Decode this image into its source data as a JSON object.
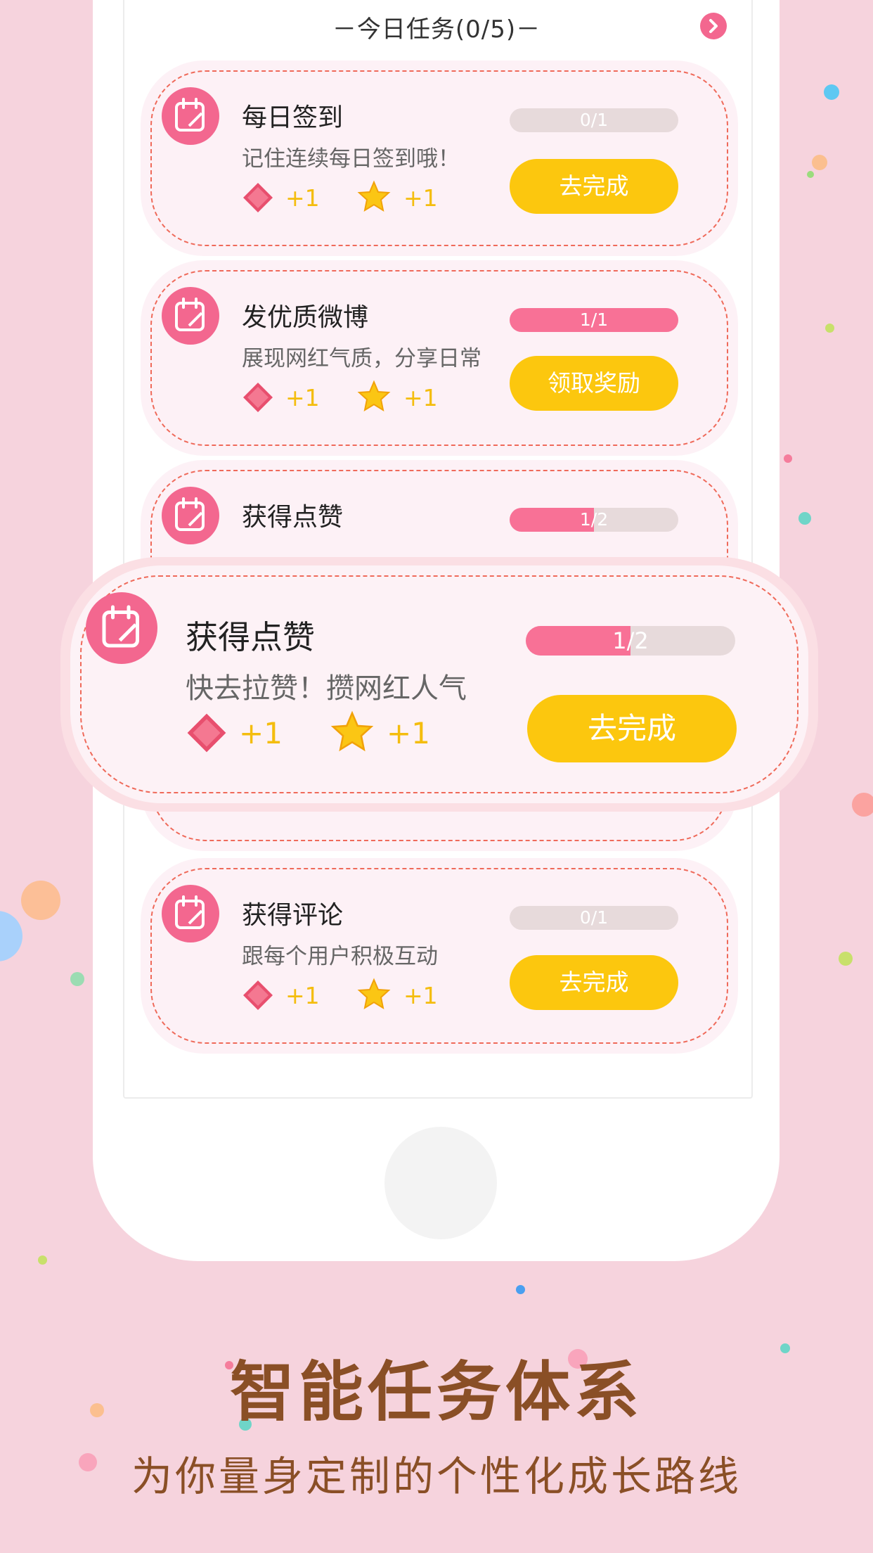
{
  "section": {
    "title": "－今日任务(0/5)－",
    "next_icon": "chevron-right-icon"
  },
  "reward_icons": {
    "gem": "diamond-icon",
    "star": "star-icon"
  },
  "tasks": [
    {
      "title": "每日签到",
      "desc": "记住连续每日签到哦！",
      "gem_reward": "+1",
      "star_reward": "+1",
      "progress_text": "0/1",
      "progress": 0.0,
      "button": "去完成"
    },
    {
      "title": "发优质微博",
      "desc": "展现网红气质，分享日常",
      "gem_reward": "+1",
      "star_reward": "+1",
      "progress_text": "1/1",
      "progress": 1.0,
      "button": "领取奖励"
    },
    {
      "title": "获得点赞",
      "desc": "快去拉赞！攒网红人气",
      "gem_reward": "+1",
      "star_reward": "+1",
      "progress_text": "1/2",
      "progress": 0.5,
      "button": "去完成"
    },
    {
      "title": "获得评论",
      "desc": "跟每个用户积极互动",
      "gem_reward": "+1",
      "star_reward": "+1",
      "progress_text": "0/1",
      "progress": 0.0,
      "button": "去完成"
    }
  ],
  "promo": {
    "title": "智能任务体系",
    "subtitle": "为你量身定制的个性化成长路线"
  },
  "colors": {
    "background": "#f6d3dd",
    "accent": "#f3678f",
    "button": "#fcc70e",
    "progress_fill": "#f87196",
    "dash": "#ef6a5a",
    "promo_text": "#8a4f26"
  }
}
